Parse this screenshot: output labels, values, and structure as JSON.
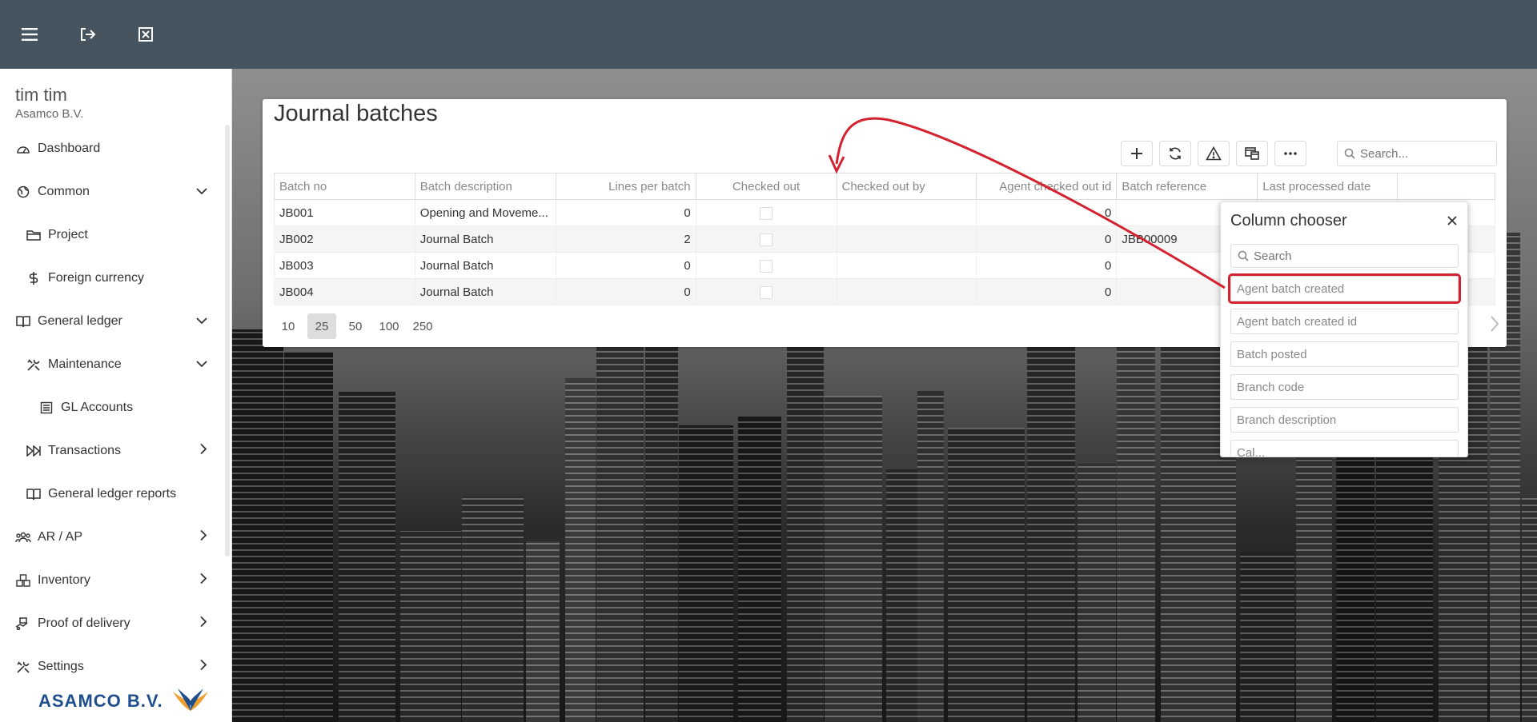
{
  "topbar": {
    "icons": [
      "menu-icon",
      "logout-icon",
      "close-window-icon"
    ]
  },
  "user": {
    "name": "tim tim",
    "company": "Asamco B.V."
  },
  "sidebar": {
    "items": [
      {
        "label": "Dashboard",
        "icon": "dashboard-icon",
        "level": 0,
        "chevron": ""
      },
      {
        "label": "Common",
        "icon": "globe-icon",
        "level": 0,
        "chevron": "down"
      },
      {
        "label": "Project",
        "icon": "folder-icon",
        "level": 1,
        "chevron": ""
      },
      {
        "label": "Foreign currency",
        "icon": "dollar-icon",
        "level": 1,
        "chevron": ""
      },
      {
        "label": "General ledger",
        "icon": "book-icon",
        "level": 0,
        "chevron": "down"
      },
      {
        "label": "Maintenance",
        "icon": "tools-icon",
        "level": 1,
        "chevron": "down"
      },
      {
        "label": "GL Accounts",
        "icon": "list-icon",
        "level": 2,
        "chevron": ""
      },
      {
        "label": "Transactions",
        "icon": "transactions-icon",
        "level": 1,
        "chevron": "right"
      },
      {
        "label": "General ledger reports",
        "icon": "book-icon",
        "level": 1,
        "chevron": ""
      },
      {
        "label": "AR / AP",
        "icon": "users-icon",
        "level": 0,
        "chevron": "right"
      },
      {
        "label": "Inventory",
        "icon": "inventory-icon",
        "level": 0,
        "chevron": "right"
      },
      {
        "label": "Proof of delivery",
        "icon": "delivery-icon",
        "level": 0,
        "chevron": "right"
      },
      {
        "label": "Settings",
        "icon": "settings-icon",
        "level": 0,
        "chevron": "right"
      }
    ],
    "logo_text": "ASAMCO B.V."
  },
  "page": {
    "title": "Journal batches"
  },
  "toolbar": {
    "buttons": [
      "add-icon",
      "refresh-icon",
      "warning-icon",
      "column-chooser-icon",
      "more-icon"
    ]
  },
  "search": {
    "placeholder": "Search..."
  },
  "grid": {
    "columns": [
      "Batch no",
      "Batch description",
      "Lines per batch",
      "Checked out",
      "Checked out by",
      "Agent checked out id",
      "Batch reference",
      "Last processed date",
      ""
    ],
    "rows": [
      {
        "batch_no": "JB001",
        "description": "Opening and Moveme...",
        "lines": "0",
        "checked_out": false,
        "checked_out_by": "",
        "agent_id": "0",
        "reference": "",
        "last_processed": ""
      },
      {
        "batch_no": "JB002",
        "description": "Journal Batch",
        "lines": "2",
        "checked_out": false,
        "checked_out_by": "",
        "agent_id": "0",
        "reference": "JBB00009",
        "last_processed": ""
      },
      {
        "batch_no": "JB003",
        "description": "Journal Batch",
        "lines": "0",
        "checked_out": false,
        "checked_out_by": "",
        "agent_id": "0",
        "reference": "",
        "last_processed": ""
      },
      {
        "batch_no": "JB004",
        "description": "Journal Batch",
        "lines": "0",
        "checked_out": false,
        "checked_out_by": "",
        "agent_id": "0",
        "reference": "",
        "last_processed": ""
      }
    ]
  },
  "pager": {
    "sizes": [
      "10",
      "25",
      "50",
      "100",
      "250"
    ],
    "active": "25"
  },
  "column_chooser": {
    "title": "Column chooser",
    "search_placeholder": "Search",
    "items": [
      "Agent batch created",
      "Agent batch created id",
      "Batch posted",
      "Branch code",
      "Branch description",
      "Cal..."
    ],
    "highlighted": "Agent batch created"
  },
  "colors": {
    "topbar": "#46545f",
    "highlight": "#d32330",
    "logo": "#1f4e8c"
  }
}
